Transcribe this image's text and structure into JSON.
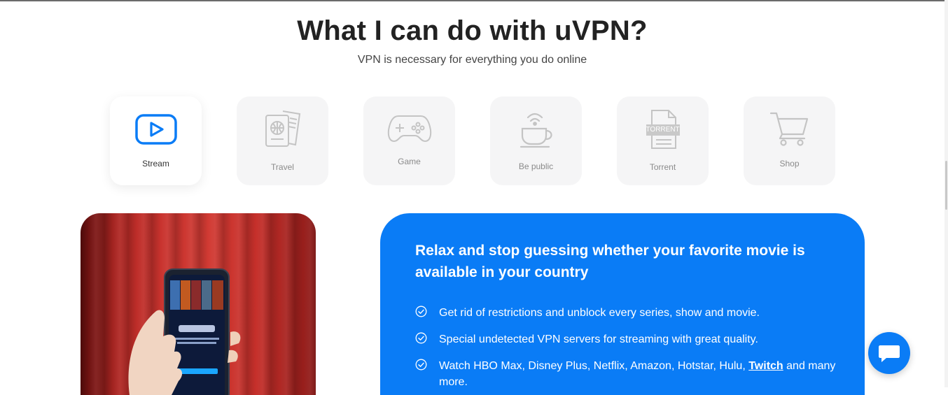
{
  "section": {
    "title": "What I can do with uVPN?",
    "subtitle": "VPN is necessary for everything you do online"
  },
  "tabs": [
    {
      "label": "Stream",
      "icon": "play-icon",
      "active": true
    },
    {
      "label": "Travel",
      "icon": "passport-icon",
      "active": false
    },
    {
      "label": "Game",
      "icon": "gamepad-icon",
      "active": false
    },
    {
      "label": "Be public",
      "icon": "coffee-wifi-icon",
      "active": false
    },
    {
      "label": "Torrent",
      "icon": "torrent-file-icon",
      "active": false
    },
    {
      "label": "Shop",
      "icon": "shopping-cart-icon",
      "active": false
    }
  ],
  "torrent_badge": "TORRENT",
  "card": {
    "heading": "Relax and stop guessing whether your favorite movie is available in your country",
    "features": [
      {
        "text": "Get rid of restrictions and unblock every series, show and movie."
      },
      {
        "text": "Special undetected VPN servers for streaming with great quality."
      },
      {
        "text_before": "Watch HBO Max, Disney Plus, Netflix, Amazon, Hotstar, Hulu, ",
        "link": "Twitch",
        "text_after": " and many more."
      }
    ]
  },
  "colors": {
    "accent": "#0a7cf6",
    "tile_bg": "#f5f5f6",
    "icon_inactive": "#c4c4c4"
  }
}
